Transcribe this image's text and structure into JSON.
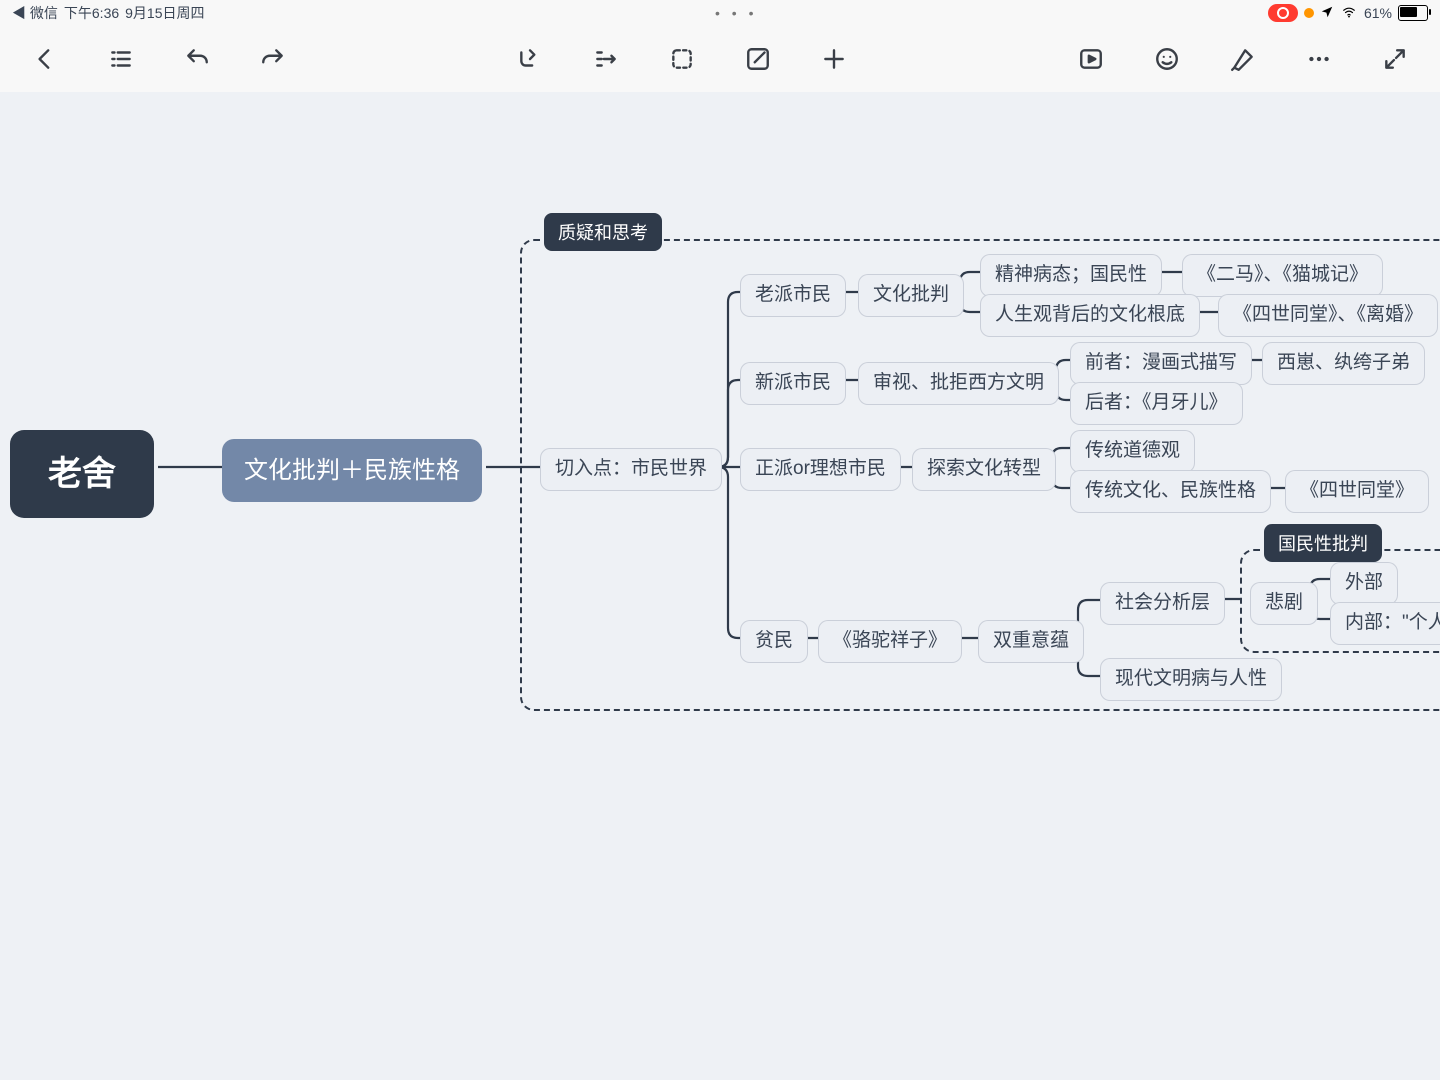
{
  "status": {
    "back_app": "◀ 微信",
    "time": "下午6:36",
    "date": "9月15日周四",
    "dots": "• • •",
    "battery_pct": "61%"
  },
  "mindmap": {
    "root": "老舍",
    "sub": "文化批判＋民族性格",
    "callout_top": "质疑和思考",
    "l3": "切入点：市民世界",
    "branch1": {
      "a": "老派市民",
      "b": "文化批判",
      "c1": "精神病态；国民性",
      "c1_w": "《二马》、《猫城记》",
      "c2": "人生观背后的文化根底",
      "c2_w": "《四世同堂》、《离婚》"
    },
    "branch2": {
      "a": "新派市民",
      "b": "审视、批拒西方文明",
      "c1": "前者：漫画式描写",
      "c1_w": "西崽、纨绔子弟",
      "c2": "后者：《月牙儿》"
    },
    "branch3": {
      "a": "正派or理想市民",
      "b": "探索文化转型",
      "c1": "传统道德观",
      "c2": "传统文化、民族性格",
      "c2_w": "《四世同堂》"
    },
    "branch4": {
      "a": "贫民",
      "w": "《骆驼祥子》",
      "b": "双重意蕴",
      "s1": "社会分析层",
      "s2": "现代文明病与人性",
      "t": "悲剧",
      "t1": "外部",
      "t2": "内部：\"个人",
      "callout": "国民性批判"
    }
  }
}
